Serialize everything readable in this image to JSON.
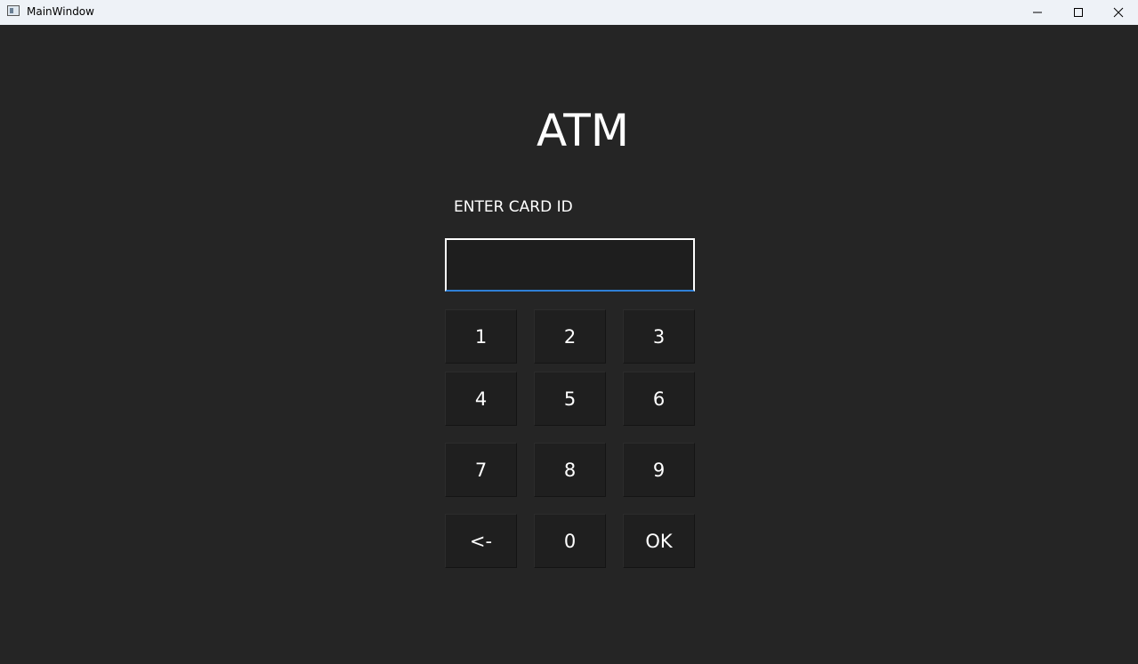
{
  "window": {
    "title": "MainWindow",
    "controls": {
      "minimize": "minimize-icon",
      "maximize": "maximize-icon",
      "close": "close-icon"
    }
  },
  "atm": {
    "title": "ATM",
    "prompt": "ENTER CARD ID",
    "card_input_value": ""
  },
  "keypad": {
    "keys": [
      "1",
      "2",
      "3",
      "4",
      "5",
      "6",
      "7",
      "8",
      "9",
      "<-",
      "0",
      "OK"
    ]
  },
  "colors": {
    "background": "#252525",
    "titlebar": "#eef2f7",
    "input_focus_accent": "#2f7fd6",
    "text": "#ffffff"
  }
}
